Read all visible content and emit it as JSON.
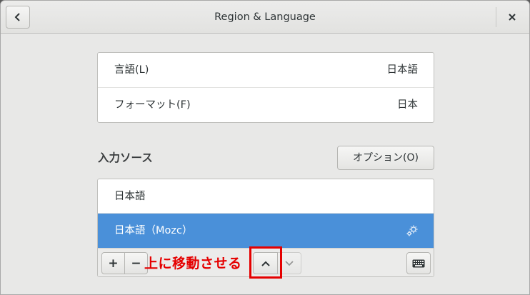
{
  "window": {
    "title": "Region & Language"
  },
  "language": {
    "label": "言語(L)",
    "value": "日本語"
  },
  "formats": {
    "label": "フォーマット(F)",
    "value": "日本"
  },
  "input_sources": {
    "heading": "入力ソース",
    "options_label": "オプション(O)",
    "items": [
      {
        "label": "日本語"
      },
      {
        "label": "日本語（Mozc）"
      }
    ],
    "toolbar": {
      "add": "+",
      "remove": "−"
    }
  },
  "annotation": {
    "text": "上に移動させる",
    "color": "#e50000"
  },
  "colors": {
    "accent": "#4a90d9"
  }
}
